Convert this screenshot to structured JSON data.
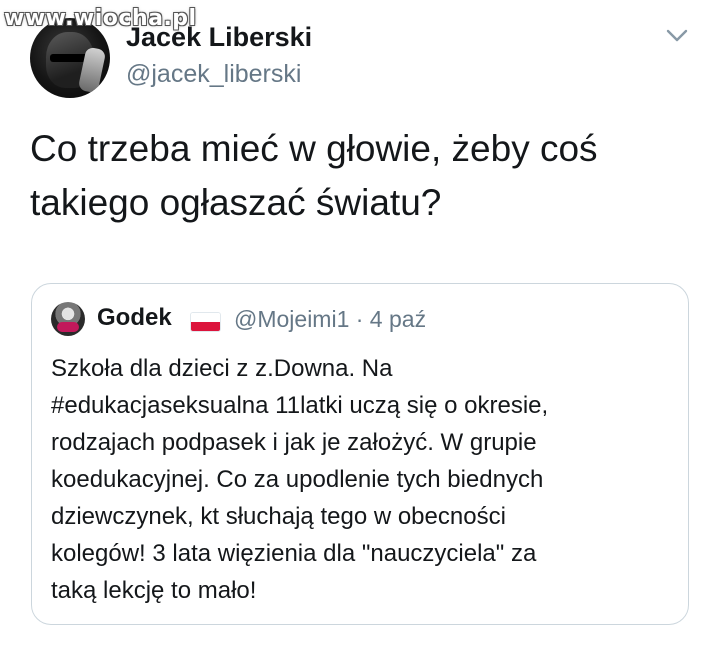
{
  "watermark": "www.wiocha.pl",
  "tweet": {
    "author_name": "Jacek Liberski",
    "author_handle": "@jacek_liberski",
    "text_lines": [
      "Co trzeba mieć w głowie, żeby coś",
      "takiego ogłaszać światu?"
    ],
    "menu_icon": "chevron-down-icon"
  },
  "quoted_tweet": {
    "author_name": "Godek",
    "flag_icon": "poland-flag-icon",
    "handle_and_date": "@Mojeimi1 · 4 paź",
    "text_lines": [
      "Szkoła dla dzieci z z.Downa. Na",
      "#edukacjaseksualna 11latki uczą się o okresie,",
      "rodzajach podpasek i jak je założyć. W grupie",
      "koedukacyjnej. Co za upodlenie tych biednych",
      "dziewczynek, kt słuchają tego w obecności",
      "kolegów! 3 lata więzienia dla \"nauczyciela\" za",
      "taką lekcję to mało!"
    ]
  },
  "colors": {
    "text_primary": "#14171a",
    "text_secondary": "#657786",
    "card_border": "#ccd6dd",
    "flag_red": "#dc143c"
  }
}
